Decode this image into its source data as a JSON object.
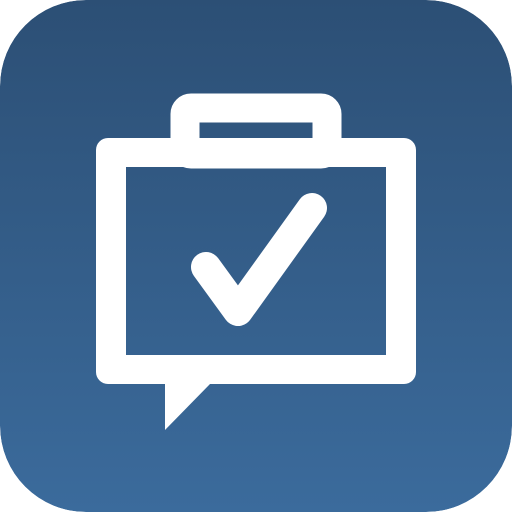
{
  "app_icon": {
    "icon_name": "briefcase-speech-bubble-checkmark-icon",
    "colors": {
      "background_top": "#2c4f75",
      "background_bottom": "#3b6b9c",
      "glyph": "#ffffff"
    }
  }
}
